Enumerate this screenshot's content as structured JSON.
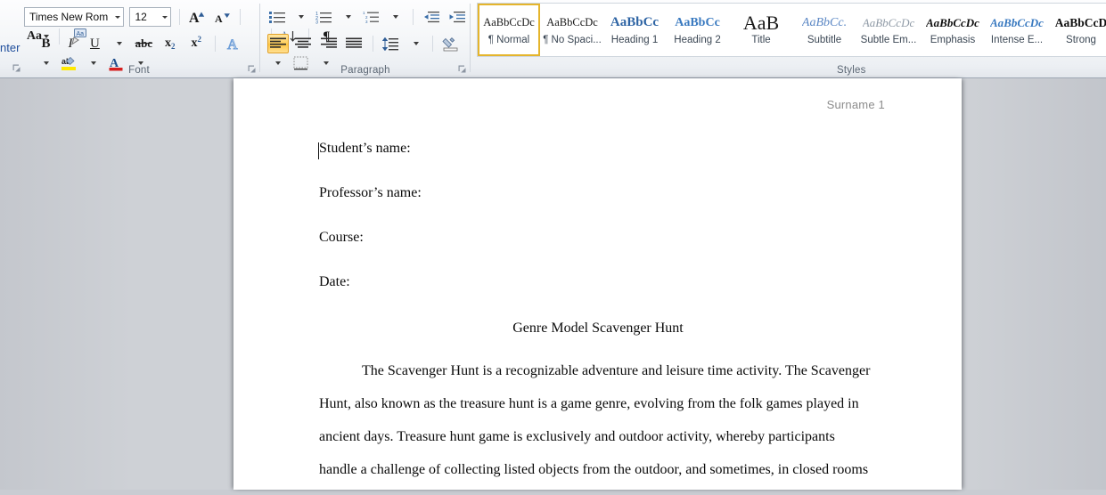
{
  "ribbon": {
    "leftover_text": "nter",
    "font_group": {
      "label": "Font",
      "font_name": "Times New Rom",
      "font_size": "12",
      "buttons": [
        {
          "name": "grow-font-button",
          "glyph": "A"
        },
        {
          "name": "shrink-font-button",
          "glyph": "A"
        },
        {
          "name": "change-case-button",
          "glyph": "Aa"
        },
        {
          "name": "clear-formatting-button",
          "glyph": "Aa"
        },
        {
          "name": "bold-button",
          "glyph": "B"
        },
        {
          "name": "italic-button",
          "glyph": "I"
        },
        {
          "name": "underline-button",
          "glyph": "U"
        },
        {
          "name": "strikethrough-button",
          "glyph": "abc"
        },
        {
          "name": "subscript-button",
          "glyph": "x2"
        },
        {
          "name": "superscript-button",
          "glyph": "x2"
        },
        {
          "name": "text-effects-button",
          "glyph": "A"
        },
        {
          "name": "text-highlight-color-button",
          "glyph": "ab"
        },
        {
          "name": "font-color-button",
          "glyph": "A"
        }
      ]
    },
    "paragraph_group": {
      "label": "Paragraph",
      "buttons": [
        {
          "name": "bullets-button"
        },
        {
          "name": "numbering-button"
        },
        {
          "name": "multilevel-list-button"
        },
        {
          "name": "decrease-indent-button"
        },
        {
          "name": "increase-indent-button"
        },
        {
          "name": "sort-button",
          "glyph": "AZ"
        },
        {
          "name": "show-formatting-marks-button",
          "glyph": "¶"
        },
        {
          "name": "align-left-button"
        },
        {
          "name": "align-center-button"
        },
        {
          "name": "align-right-button"
        },
        {
          "name": "justify-button"
        },
        {
          "name": "line-spacing-button"
        },
        {
          "name": "shading-button"
        },
        {
          "name": "borders-button"
        }
      ],
      "selected": "align-left-button"
    },
    "styles_group": {
      "label": "Styles",
      "items": [
        {
          "preview": "AaBbCcDc",
          "name": "¶ Normal",
          "active": true,
          "color": "#1a1a1a",
          "weight": "normal",
          "style": "normal",
          "size": "12.5px"
        },
        {
          "preview": "AaBbCcDc",
          "name": "¶ No Spaci...",
          "active": false,
          "color": "#1a1a1a",
          "weight": "normal",
          "style": "normal",
          "size": "12.5px"
        },
        {
          "preview": "AaBbCс",
          "name": "Heading 1",
          "active": false,
          "color": "#2e64a4",
          "weight": "bold",
          "style": "normal",
          "size": "15px"
        },
        {
          "preview": "AaBbCc",
          "name": "Heading 2",
          "active": false,
          "color": "#3a7ac0",
          "weight": "bold",
          "style": "normal",
          "size": "14px"
        },
        {
          "preview": "AaB",
          "name": "Title",
          "active": false,
          "color": "#1a1a1a",
          "weight": "normal",
          "style": "normal",
          "size": "22px"
        },
        {
          "preview": "AaBbCc.",
          "name": "Subtitle",
          "active": false,
          "color": "#5b87c4",
          "weight": "normal",
          "style": "italic",
          "size": "14px"
        },
        {
          "preview": "AaBbCcDс",
          "name": "Subtle Em...",
          "active": false,
          "color": "#8f9aa6",
          "weight": "normal",
          "style": "italic",
          "size": "13px"
        },
        {
          "preview": "AaBbCcDc",
          "name": "Emphasis",
          "active": false,
          "color": "#111111",
          "weight": "bold",
          "style": "italic",
          "size": "13px"
        },
        {
          "preview": "AaBbCcDс",
          "name": "Intense E...",
          "active": false,
          "color": "#3a7ac0",
          "weight": "bold",
          "style": "italic",
          "size": "13px"
        },
        {
          "preview": "AaBbCcD",
          "name": "Strong",
          "active": false,
          "color": "#111111",
          "weight": "bold",
          "style": "normal",
          "size": "13.5px"
        }
      ]
    }
  },
  "document": {
    "header_text": "Surname 1",
    "fields": [
      "Student’s name:",
      "Professor’s name:",
      "Course:",
      "Date:"
    ],
    "title": "Genre Model Scavenger Hunt",
    "paragraph_lines": [
      "The Scavenger Hunt is a recognizable adventure and leisure time activity. The Scavenger",
      "Hunt, also known as the treasure hunt is a game genre, evolving from the folk games played in",
      "ancient days. Treasure hunt game is exclusively and outdoor activity, whereby participants",
      "handle a challenge of collecting listed objects from the outdoor, and sometimes, in closed rooms"
    ]
  },
  "colors": {
    "accent_selected": "#ffc63f",
    "ribbon_bg": "#f2f5f8",
    "canvas_bg": "#cbced4",
    "page_bg": "#ffffff",
    "header_gray": "#8c8c8c",
    "style_blue": "#3a7ac0"
  }
}
